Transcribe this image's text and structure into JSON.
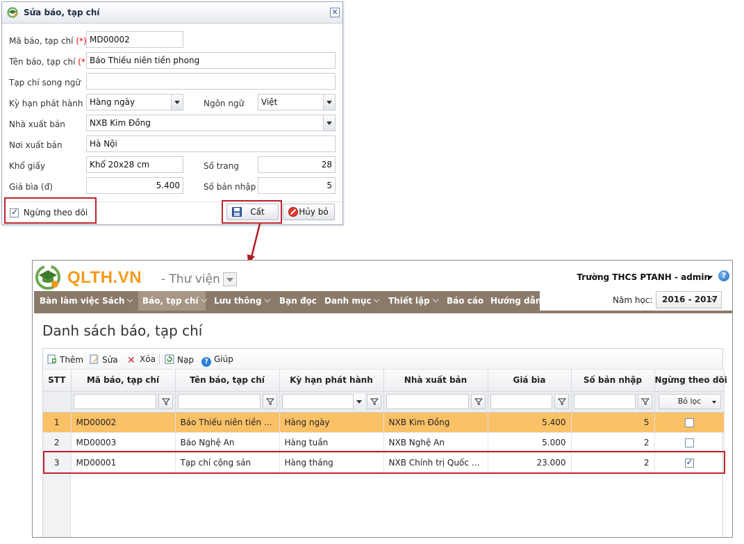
{
  "dialog": {
    "title": "Sửa báo, tạp chí",
    "fields": {
      "code_label": "Mã báo, tạp chí ",
      "code_value": "MD00002",
      "name_label": "Tên báo, tạp chí ",
      "name_value": "Báo Thiếu niên tiền phong",
      "required_mark": "(*)",
      "bilingual_label": "Tạp chí song ngữ",
      "bilingual_value": "",
      "period_label": "Kỳ hạn phát hành",
      "period_value": "Hàng ngày",
      "language_label": "Ngôn ngữ",
      "language_value": "Việt",
      "publisher_label": "Nhà xuất bản",
      "publisher_value": "NXB Kim Đồng",
      "place_label": "Nơi xuất bản",
      "place_value": "Hà Nội",
      "size_label": "Khổ giấy",
      "size_value": "Khổ 20x28 cm",
      "pages_label": "Số trang",
      "pages_value": "28",
      "price_label": "Giá bìa (đ)",
      "price_value": "5.400",
      "copies_label": "Số bản nhập",
      "copies_value": "5"
    },
    "stop_tracking_label": "Ngừng theo dõi",
    "stop_tracking_checked": true,
    "save_label": "Cất",
    "cancel_label": "Hủy bỏ"
  },
  "app": {
    "brand": "QLTH.VN",
    "module": "- Thư viện",
    "user": "Trường THCS PTANH - admin",
    "menu": [
      {
        "label": "Bàn làm việc",
        "dropdown": false
      },
      {
        "label": "Sách",
        "dropdown": true
      },
      {
        "label": "Báo, tạp chí",
        "dropdown": true,
        "active": true
      },
      {
        "label": "Lưu thông",
        "dropdown": true
      },
      {
        "label": "Bạn đọc",
        "dropdown": false
      },
      {
        "label": "Danh mục",
        "dropdown": true
      },
      {
        "label": "Thiết lập",
        "dropdown": true
      },
      {
        "label": "Báo cáo",
        "dropdown": false
      },
      {
        "label": "Hướng dẫn",
        "dropdown": false
      }
    ],
    "year_label": "Năm học:",
    "year_value": "2016 - 2017",
    "page_title": "Danh sách báo, tạp chí",
    "toolbar": {
      "add": "Thêm",
      "edit": "Sửa",
      "delete": "Xóa",
      "reload": "Nạp",
      "help": "Giúp"
    },
    "table": {
      "columns": [
        "STT",
        "Mã báo, tạp chí",
        "Tên báo, tạp chí",
        "Kỳ hạn phát hành",
        "Nhà xuất bản",
        "Giá bìa",
        "Số bản nhập",
        "Ngừng theo dõi"
      ],
      "filter_label": "Bỏ lọc",
      "rows": [
        {
          "stt": "1",
          "code": "MD00002",
          "name": "Báo Thiếu niên tiền pho...",
          "period": "Hàng ngày",
          "publisher": "NXB Kim Đồng",
          "price": "5.400",
          "copies": "5",
          "stopped": false
        },
        {
          "stt": "2",
          "code": "MD00003",
          "name": "Báo Nghệ An",
          "period": "Hàng tuần",
          "publisher": "NXB Nghệ An",
          "price": "5.000",
          "copies": "2",
          "stopped": false
        },
        {
          "stt": "3",
          "code": "MD00001",
          "name": "Tạp chí cộng sản",
          "period": "Hàng tháng",
          "publisher": "NXB Chính trị Quốc gia",
          "price": "23.000",
          "copies": "2",
          "stopped": true
        }
      ]
    }
  },
  "colors": {
    "accent_red": "#c0232b",
    "menu_bg": "#8b7a6a",
    "selected_row": "#fbc167",
    "brand_orange": "#f59a1c"
  }
}
